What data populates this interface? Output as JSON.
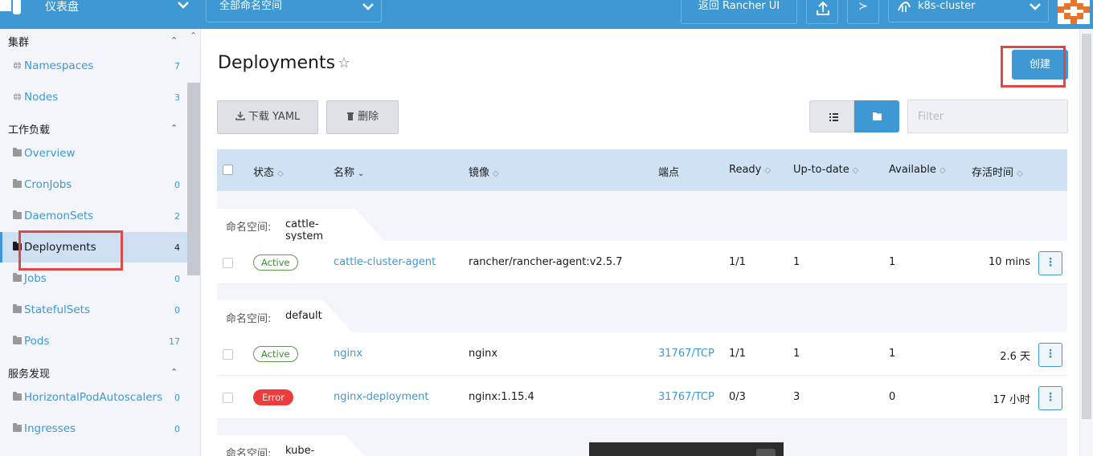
{
  "topbar": {
    "dashboard_title": "仪表盘",
    "namespace_selector": "全部命名空间",
    "rancher_button": "返回 Rancher UI",
    "cluster_name": "k8s-cluster",
    "shell_glyph": "≻"
  },
  "sidebar": {
    "groups": [
      {
        "label": "集群",
        "items": [
          {
            "label": "Namespaces",
            "count": "7"
          },
          {
            "label": "Nodes",
            "count": "3"
          }
        ]
      },
      {
        "label": "工作负载",
        "items": [
          {
            "label": "Overview",
            "count": ""
          },
          {
            "label": "CronJobs",
            "count": "0"
          },
          {
            "label": "DaemonSets",
            "count": "2"
          },
          {
            "label": "Deployments",
            "count": "4"
          },
          {
            "label": "Jobs",
            "count": "0"
          },
          {
            "label": "StatefulSets",
            "count": "0"
          },
          {
            "label": "Pods",
            "count": "17"
          }
        ]
      },
      {
        "label": "服务发现",
        "items": [
          {
            "label": "HorizontalPodAutoscalers",
            "count": "0"
          },
          {
            "label": "Ingresses",
            "count": "0"
          }
        ]
      }
    ]
  },
  "main": {
    "title": "Deployments",
    "create_button": "创建",
    "download_yaml_button": "下载 YAML",
    "delete_button": "删除",
    "filter_placeholder": "Filter",
    "columns": {
      "state": "状态",
      "name": "名称",
      "image": "镜像",
      "endpoints": "端点",
      "ready": "Ready",
      "up_to_date": "Up-to-date",
      "available": "Available",
      "age": "存活时间"
    },
    "namespace_label": "命名空间:",
    "groups": [
      {
        "namespace": "cattle-system",
        "rows": [
          {
            "state": "Active",
            "name": "cattle-cluster-agent",
            "image": "rancher/rancher-agent:v2.5.7",
            "endpoints": "",
            "ready": "1/1",
            "up_to_date": "1",
            "available": "1",
            "age": "10 mins"
          }
        ]
      },
      {
        "namespace": "default",
        "rows": [
          {
            "state": "Active",
            "name": "nginx",
            "image": "nginx",
            "endpoints": "31767/TCP",
            "ready": "1/1",
            "up_to_date": "1",
            "available": "1",
            "age": "2.6 天"
          },
          {
            "state": "Error",
            "name": "nginx-deployment",
            "image": "nginx:1.15.4",
            "endpoints": "31767/TCP",
            "ready": "0/3",
            "up_to_date": "3",
            "available": "0",
            "age": "17 小时"
          }
        ]
      },
      {
        "namespace": "kube-system",
        "rows": []
      }
    ]
  },
  "colors": {
    "brand": "#3d98d3",
    "active_badge": "#3f8a33",
    "error_badge": "#ee3b3b",
    "highlight_box": "#e04848"
  }
}
